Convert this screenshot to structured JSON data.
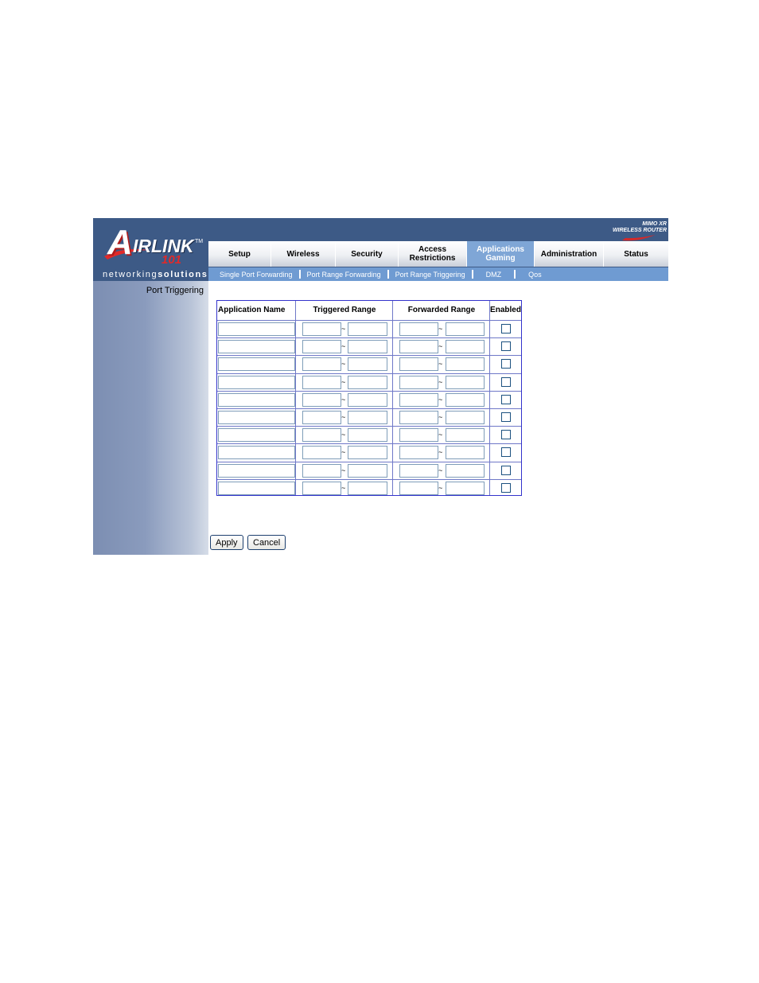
{
  "logo": {
    "letter_a": "A",
    "rest": "IRLINK",
    "number": "101",
    "tm": "TM"
  },
  "tagline": {
    "part1": "networking",
    "part2": "solutions"
  },
  "brand": {
    "line1": "MIMO XR",
    "line2": "WIRELESS ROUTER"
  },
  "tabs": [
    {
      "label": "Setup"
    },
    {
      "label": "Wireless"
    },
    {
      "label": "Security"
    },
    {
      "label": "Access Restrictions"
    },
    {
      "label": "Applications Gaming",
      "active": true
    },
    {
      "label": "Administration"
    },
    {
      "label": "Status"
    }
  ],
  "subnav": [
    "Single Port Forwarding",
    "Port Range Forwarding",
    "Port Range Triggering",
    "DMZ",
    "Qos"
  ],
  "sidebar": {
    "title": "Port Triggering"
  },
  "table": {
    "headers": {
      "app": "Application Name",
      "triggered": "Triggered Range",
      "forwarded": "Forwarded Range",
      "enabled": "Enabled"
    },
    "tilde": "~",
    "rows": 10
  },
  "buttons": {
    "apply": "Apply",
    "cancel": "Cancel"
  },
  "colors": {
    "header": "#3d5a86",
    "subnav": "#6f9bd2",
    "active_tab": "#7fa6d6",
    "table_border": "#3333cc",
    "logo_red": "#e02a2a"
  }
}
